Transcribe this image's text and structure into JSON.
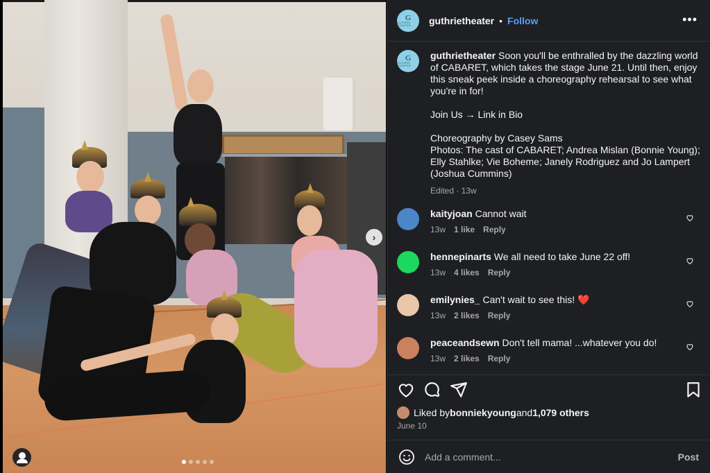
{
  "post": {
    "username": "guthrietheater",
    "separator": "•",
    "follow_label": "Follow",
    "more_label": "•••",
    "avatar_letter": "G",
    "avatar_text": "GUTHRIE THEATER",
    "brand_color": "#8fd0e6",
    "accent_color": "#4fa3f7"
  },
  "caption": {
    "username": "guthrietheater",
    "text": " Soon you'll be enthralled by the dazzling world of CABARET, which takes the stage June 21. Until then, enjoy this sneak peek inside a choreography rehearsal to see what you're in for!",
    "join": "Join Us → Link in Bio",
    "credits": "Choreography by Casey Sams\nPhotos: The cast of CABARET; Andrea Mislan (Bonnie Young); Elly Stahlke; Vie Boheme; Janely Rodriguez and Jo Lampert (Joshua Cummins)",
    "edited": "Edited",
    "meta_sep": " · ",
    "time": "13w"
  },
  "comments": [
    {
      "username": "kaityjoan",
      "text": " Cannot wait",
      "time": "13w",
      "likes": "1 like",
      "reply": "Reply",
      "avatar_color": "#4a86c8"
    },
    {
      "username": "hennepinarts",
      "text": " We all need to take June 22 off!",
      "time": "13w",
      "likes": "4 likes",
      "reply": "Reply",
      "avatar_color": "#1ed760"
    },
    {
      "username": "emilynies_",
      "text": " Can't wait to see this! ❤️",
      "time": "13w",
      "likes": "2 likes",
      "reply": "Reply",
      "avatar_color": "#e9c7a8"
    },
    {
      "username": "peaceandsewn",
      "text": " Don't tell mama! ...whatever you do!",
      "time": "13w",
      "likes": "2 likes",
      "reply": "Reply",
      "avatar_color": "#c9815e"
    }
  ],
  "likes": {
    "prefix": "Liked by ",
    "user": "bonniekyoung",
    "mid": " and ",
    "others": "1,079 others"
  },
  "date": "June 10",
  "add_comment": {
    "placeholder": "Add a comment...",
    "post_label": "Post"
  },
  "carousel": {
    "slide_count": 5,
    "active_index": 0,
    "next_label": "›"
  }
}
